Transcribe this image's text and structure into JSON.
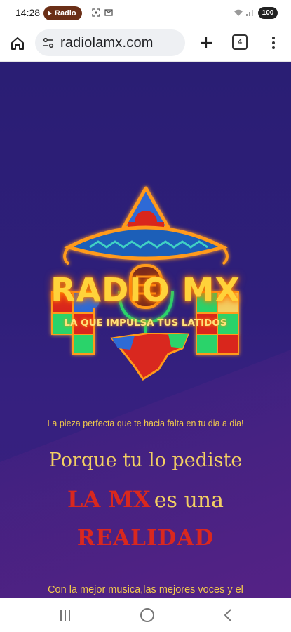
{
  "status_bar": {
    "time": "14:28",
    "chip_label": "Radio",
    "battery": "100"
  },
  "browser": {
    "url": "radiolamx.com",
    "tab_count": "4"
  },
  "page": {
    "logo_title": "RADIO MX",
    "logo_subtitle": "LA QUE IMPULSA TUS LATIDOS",
    "tagline": "La pieza perfecta que te hacia falta en tu dia a dia!",
    "headline": "Porque tu lo pediste",
    "mx_red": "LA MX",
    "mx_yellow": "es una",
    "realidad": "REALIDAD",
    "bottom_text": "Con la mejor musica,las mejores voces y el"
  },
  "colors": {
    "background": "#2a1e74",
    "accent_yellow": "#f3cf63",
    "accent_red": "#d9281f"
  }
}
